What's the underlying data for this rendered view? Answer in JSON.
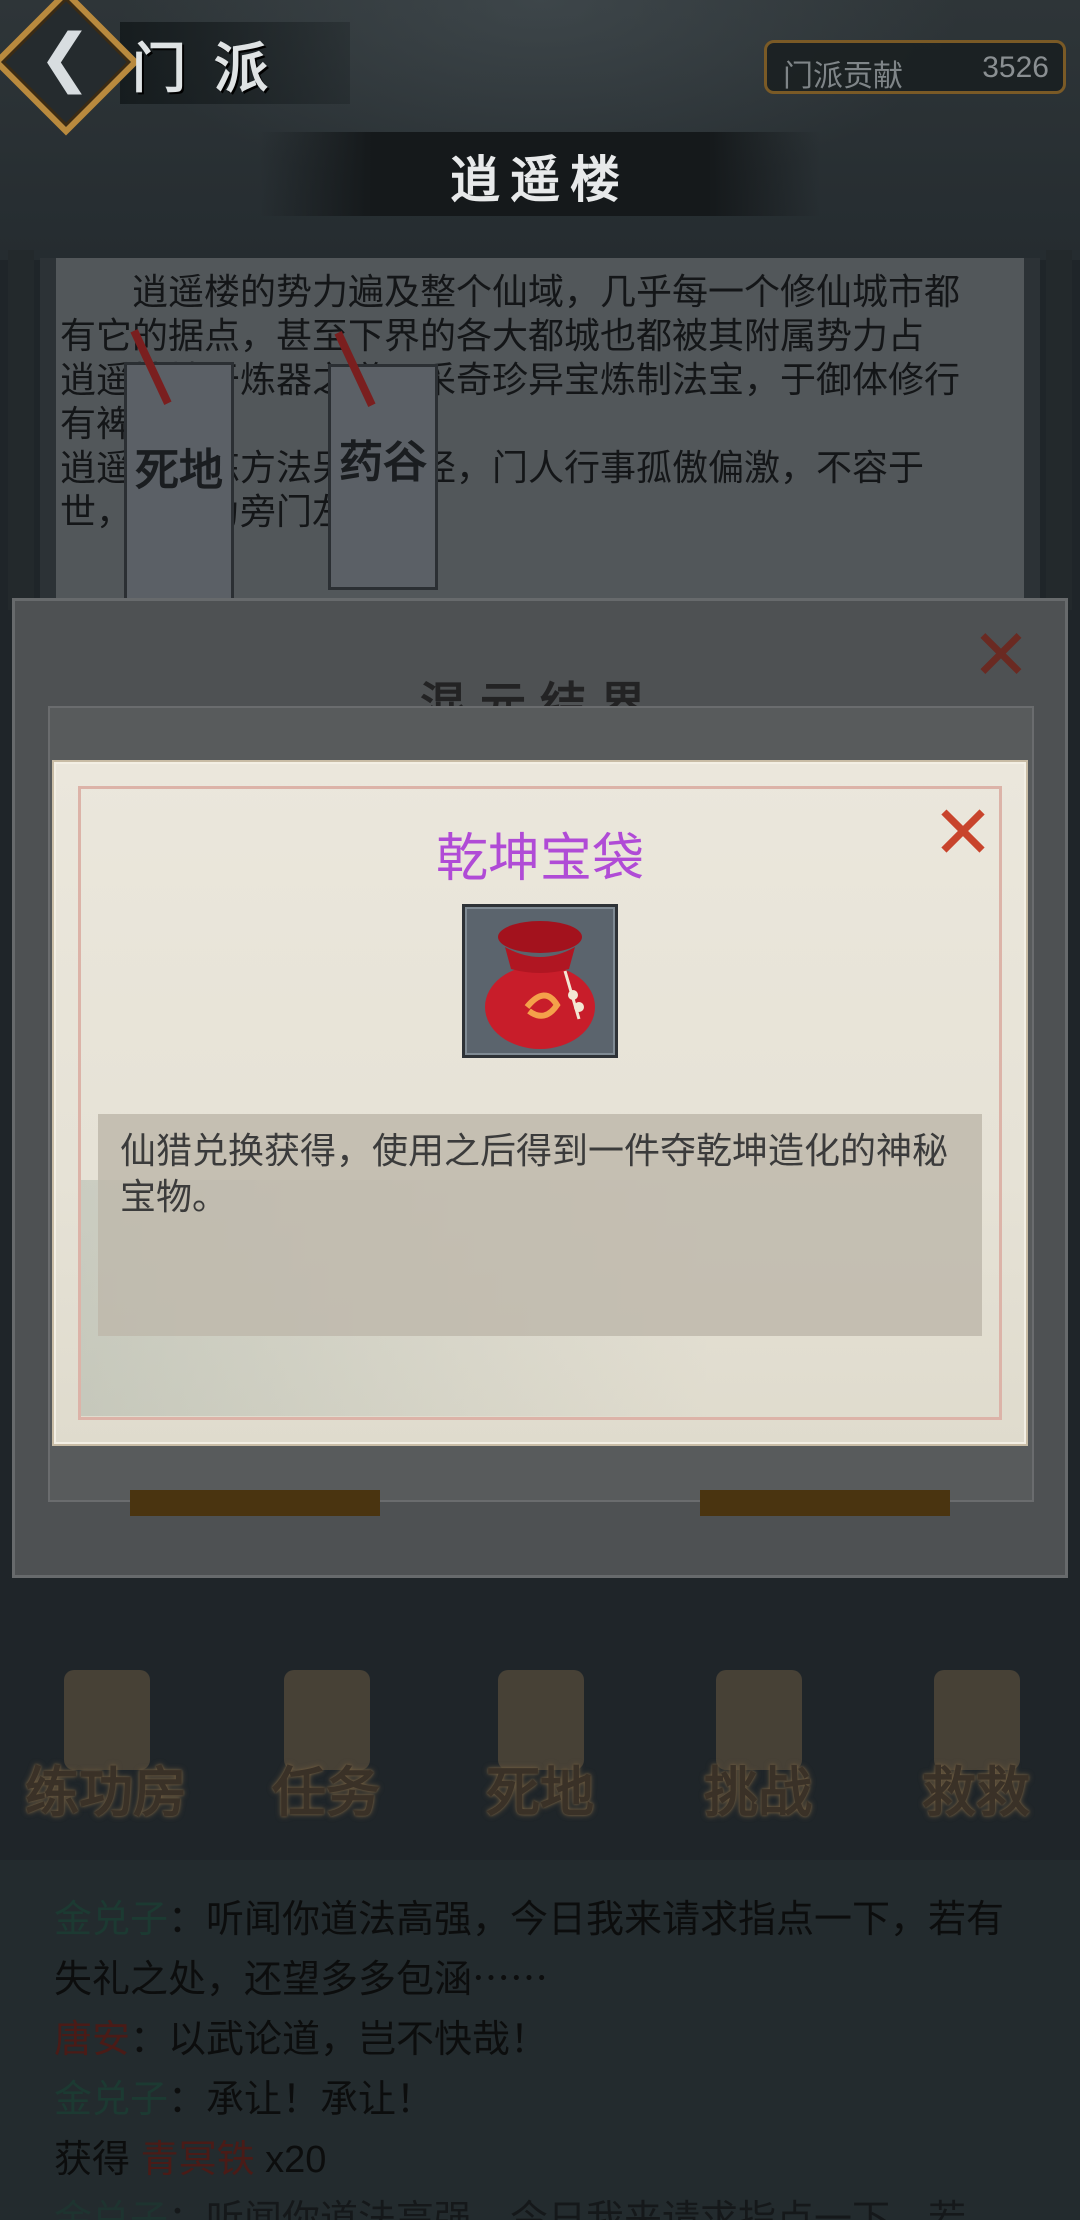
{
  "header": {
    "title": "门派",
    "contribution_label": "门派贡献",
    "contribution_value": "3526"
  },
  "banner": {
    "title": "逍遥楼"
  },
  "intro": {
    "text": "逍遥楼的势力遍及整个仙域，几乎每一个修仙城市都有它的据点，甚至下界的各大都城也都被其附属势力占\n逍遥楼精于炼器之道，采奇珍异宝炼制法宝，于御体修行有裨益\n逍遥楼修炼方法另辟蹊径，门人行事孤傲偏激，不容于世，被视为旁门左道。"
  },
  "tags": [
    {
      "label": "死地"
    },
    {
      "label": "药谷"
    }
  ],
  "dialog_back": {
    "title": "混元结界"
  },
  "item_popup": {
    "name": "乾坤宝袋",
    "name_color": "#b04bd6",
    "icon": "red-pouch-icon",
    "description": "仙猎兑换获得，使用之后得到一件夺乾坤造化的神秘宝物。"
  },
  "nav": [
    {
      "label": "练功房",
      "icon": "training-hall-icon"
    },
    {
      "label": "任务",
      "icon": "task-scroll-icon"
    },
    {
      "label": "死地",
      "icon": "flame-icon"
    },
    {
      "label": "挑战",
      "icon": "gate-icon"
    },
    {
      "label": "救救",
      "icon": "crossed-swords-icon"
    }
  ],
  "log": [
    {
      "speaker": "金兑子",
      "sep": "：",
      "text": "听闻你道法高强，今日我来请求指点一下，若有失礼之处，还望多多包涵⋯⋯"
    },
    {
      "speaker": "唐安",
      "sep": "：",
      "text": "以武论道，岂不快哉！"
    },
    {
      "speaker": "金兑子",
      "sep": "：",
      "text": "承让！承让！"
    },
    {
      "prefix": "获得 ",
      "item": "青冥铁",
      "suffix": " x20"
    },
    {
      "speaker": "金兑子",
      "sep": "：",
      "text": "听闻你道法高强，今日我来请求指点一下，若"
    }
  ]
}
